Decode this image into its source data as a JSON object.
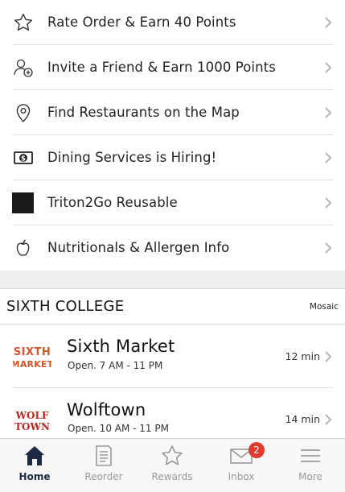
{
  "menu": {
    "items": [
      {
        "label": "Rate Order & Earn 40 Points",
        "icon": "star-outline-icon"
      },
      {
        "label": "Invite a Friend & Earn 1000 Points",
        "icon": "add-person-icon"
      },
      {
        "label": "Find Restaurants on the Map",
        "icon": "map-pin-icon"
      },
      {
        "label": "Dining Services is Hiring!",
        "icon": "dollar-bill-icon"
      },
      {
        "label": "Triton2Go Reusable",
        "icon": "black-square-icon"
      },
      {
        "label": "Nutritionals & Allergen Info",
        "icon": "apple-icon"
      }
    ]
  },
  "college": {
    "name": "SIXTH COLLEGE",
    "link": "Mosaic"
  },
  "restaurants": [
    {
      "name": "Sixth Market",
      "hours": "Open. 7 AM - 11 PM",
      "wait": "12 min",
      "logo_lines": [
        "SIXTH",
        "MARKET"
      ],
      "logo_color": "#d4542c"
    },
    {
      "name": "Wolftown",
      "hours": "Open. 10 AM - 11 PM",
      "wait": "14 min",
      "logo_lines": [
        "WOLF",
        "TOWN"
      ],
      "logo_color": "#b8261e"
    }
  ],
  "tabbar": {
    "tabs": [
      {
        "label": "Home",
        "active": true
      },
      {
        "label": "Reorder"
      },
      {
        "label": "Rewards"
      },
      {
        "label": "Inbox",
        "badge": "2"
      },
      {
        "label": "More"
      }
    ]
  },
  "colors": {
    "active_tab": "#1d2a44",
    "inactive_tab": "#9a9a9a",
    "badge": "#e23b2c",
    "separator": "#e1e1e1"
  }
}
